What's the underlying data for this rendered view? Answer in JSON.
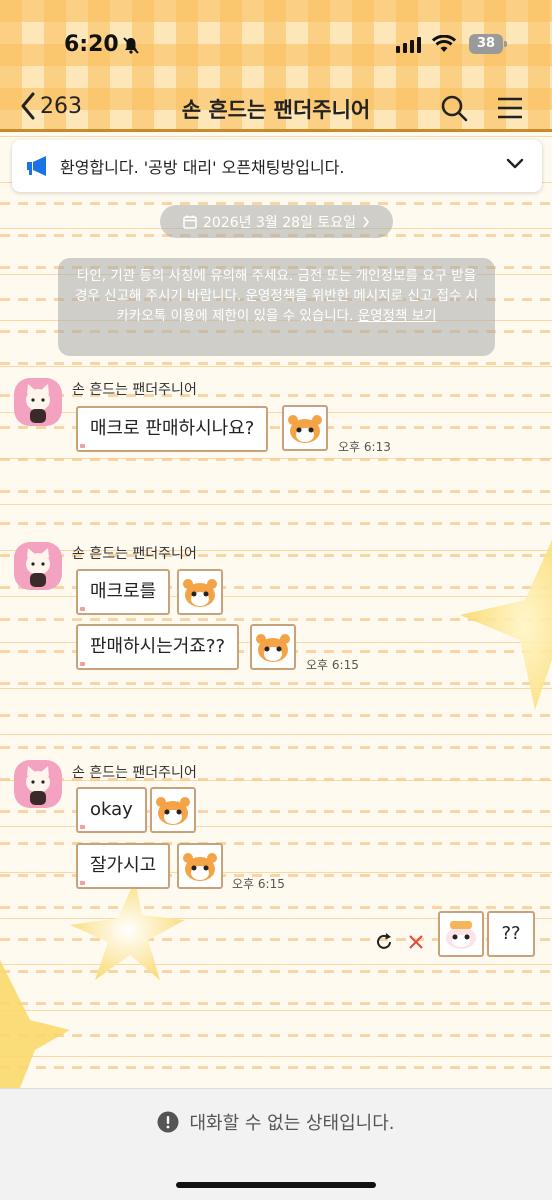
{
  "status_bar": {
    "time": "6:20",
    "battery": "38"
  },
  "nav": {
    "back_count": "263",
    "title": "손 흔드는 팬더주니어"
  },
  "notice": {
    "text": "환영합니다. '공방 대리' 오픈채팅방입니다."
  },
  "date": "2026년 3월 28일 토요일",
  "system_message": {
    "text": "타인, 기관 등의 사칭에 유의해 주세요. 금전 또는 개인정보를 요구 받을 경우 신고해 주시기 바랍니다. 운영정책을 위반한 메시지로 신고 접수 시 카카오톡 이용에 제한이 있을 수 있습니다.",
    "link": "운영정책 보기"
  },
  "messages": [
    {
      "sender": "손 흔드는 팬더주니어",
      "bubbles": [
        "매크로 판매하시나요?"
      ],
      "time": "오후 6:13"
    },
    {
      "sender": "손 흔드는 팬더주니어",
      "bubbles": [
        "매크로를",
        "판매하시는거죠??"
      ],
      "time": "오후 6:15"
    },
    {
      "sender": "손 흔드는 팬더주니어",
      "bubbles": [
        "okay",
        "잘가시고"
      ],
      "time": "오후 6:15"
    }
  ],
  "my_message": {
    "text": "??"
  },
  "footer": {
    "text": "대화할 수 없는 상태입니다."
  },
  "colors": {
    "header_bg": "#fde7b8",
    "accent_blue": "#1a73e8",
    "bubble_border": "#c8a27a"
  }
}
